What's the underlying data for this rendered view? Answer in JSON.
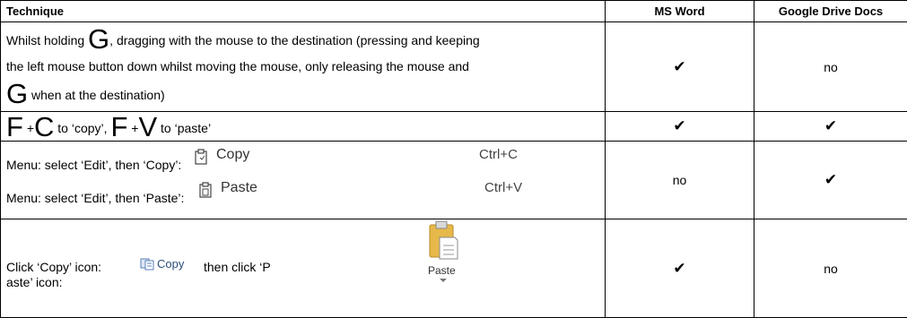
{
  "headers": {
    "technique": "Technique",
    "ms_word": "MS Word",
    "google_docs": "Google Drive Docs"
  },
  "row1": {
    "key_g": "G",
    "text_a": ", dragging with the mouse to the destination (pressing and keeping",
    "prefix": "Whilst holding ",
    "line2": "the left mouse button down whilst moving the mouse, only releasing the mouse and",
    "key_g2": "G",
    "line3": " when at the destination)",
    "ms_word": "✔",
    "google_docs": "no"
  },
  "row2": {
    "key_f": "F",
    "plus_c": " +",
    "key_c": "C",
    "copy_text": " to ‘copy’, ",
    "key_f2": "F",
    "plus_v": " +",
    "key_v": "V",
    "paste_text": " to ‘paste’",
    "ms_word": "✔",
    "google_docs": "✔"
  },
  "row3": {
    "copy_label": "Menu: select ‘Edit’, then ‘Copy’:",
    "copy_item": "Copy",
    "copy_shortcut": "Ctrl+C",
    "paste_label": "Menu: select ‘Edit’, then ‘Paste’:",
    "paste_item": "Paste",
    "paste_shortcut": "Ctrl+V",
    "ms_word": "no",
    "google_docs": "✔"
  },
  "row4": {
    "prefix": "Click ‘Copy’ icon:",
    "copy_icon_label": "Copy",
    "then": "then click ‘P",
    "line2": "aste’ icon:",
    "paste_icon_label": "Paste",
    "ms_word": "✔",
    "google_docs": "no"
  },
  "icons": {
    "copy_menu": "clipboard-icon",
    "paste_menu": "clipboard-icon",
    "copy_ribbon": "copy-icon",
    "paste_ribbon": "paste-clipboard-icon"
  }
}
